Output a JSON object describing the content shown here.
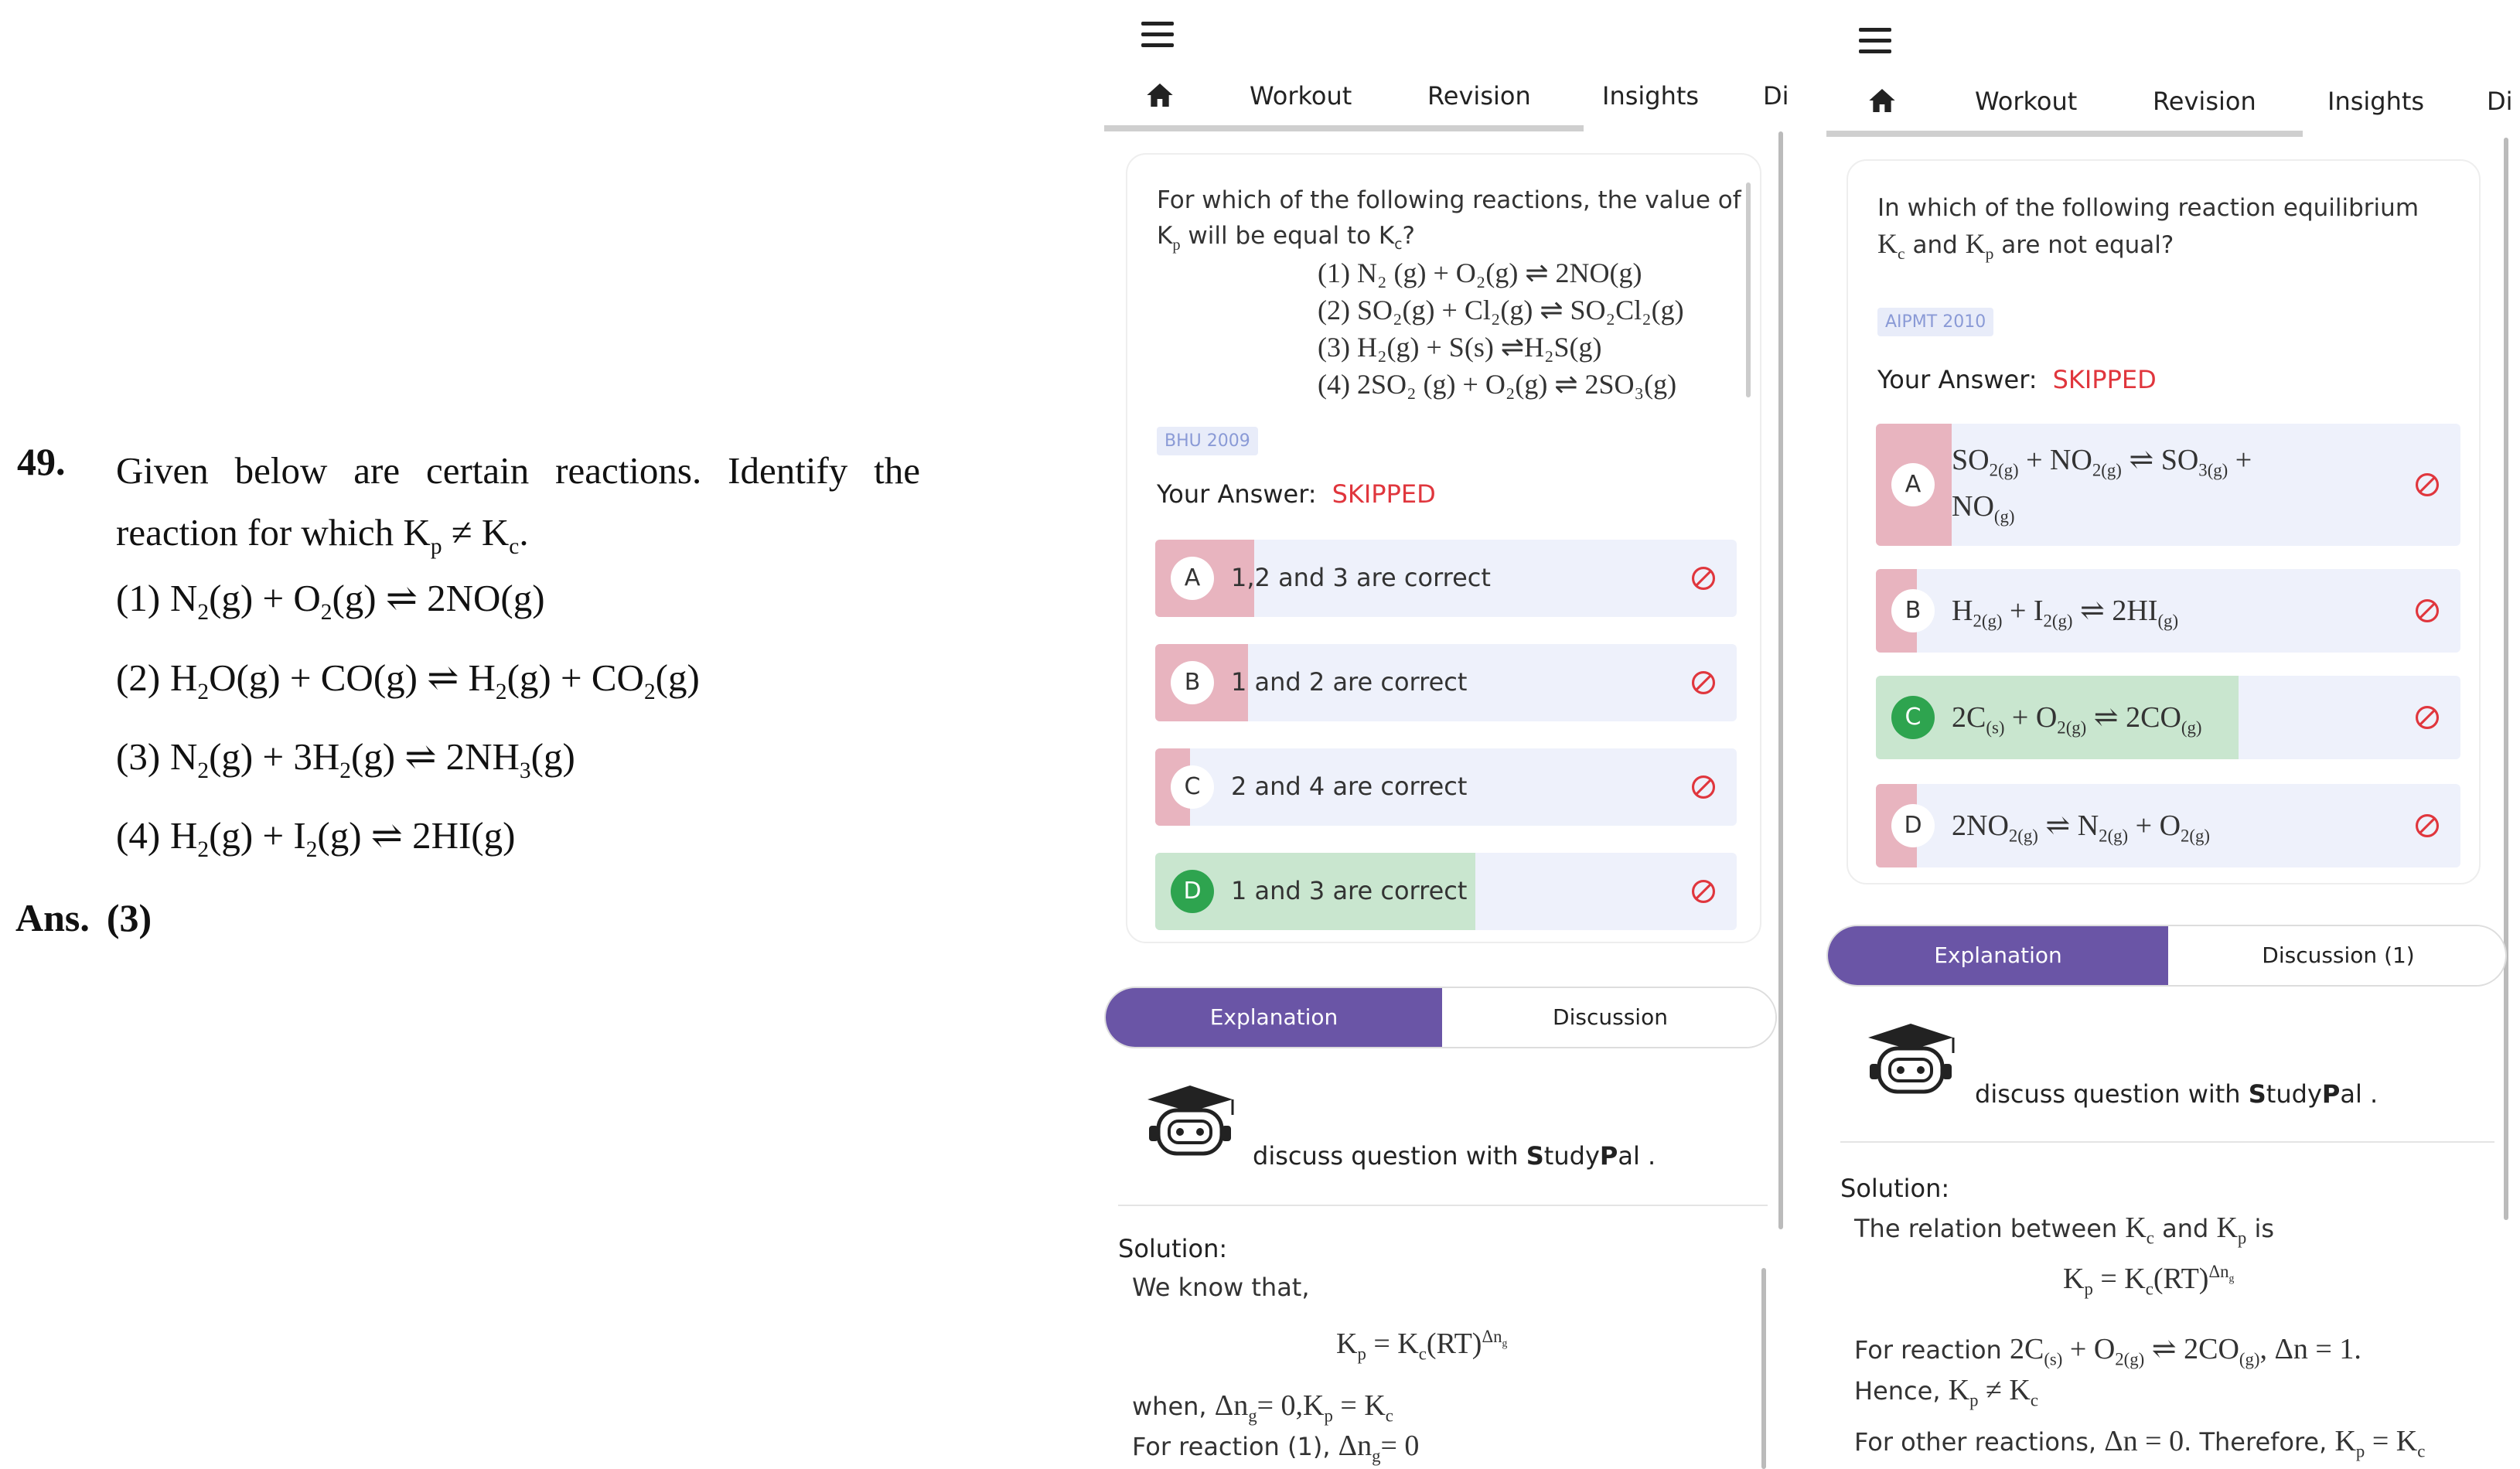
{
  "book": {
    "qnum": "49.",
    "question_line1": "Given below are certain reactions. Identify the",
    "question_line2": "reaction for which K",
    "options": [
      {
        "n": "(1)",
        "text": "N2(g) + O2(g) ⇌ 2NO(g)"
      },
      {
        "n": "(2)",
        "text": "H2O(g) + CO(g) ⇌ H2(g) + CO2(g)"
      },
      {
        "n": "(3)",
        "text": "N2(g) + 3H2(g) ⇌ 2NH3(g)"
      },
      {
        "n": "(4)",
        "text": "H2(g) + I2(g) ⇌ 2HI(g)"
      }
    ],
    "ans_label": "Ans.",
    "ans_value": "(3)"
  },
  "panel1": {
    "tabs": [
      "Workout",
      "Revision",
      "Insights",
      "Di"
    ],
    "question": "For which of the following reactions, the value of K",
    "reactions": [
      "(1) N₂ (g) + O₂(g) ⇌ 2NO(g)",
      "(2) SO₂(g) + Cl₂(g) ⇌ SO₂Cl₂(g)",
      "(3) H₂(g) + S(s) ⇌H₂S(g)",
      "(4) 2SO₂ (g) + O₂(g) ⇌ 2SO₃(g)"
    ],
    "badge": "BHU 2009",
    "your_answer_label": "Your Answer:",
    "your_answer_value": "SKIPPED",
    "options": [
      {
        "letter": "A",
        "text": "1,2 and 3 are correct",
        "fill": 0.17,
        "color": "#e8b4bf"
      },
      {
        "letter": "B",
        "text": "1 and 2 are correct",
        "fill": 0.16,
        "color": "#e8b4bf"
      },
      {
        "letter": "C",
        "text": "2 and 4 are correct",
        "fill": 0.06,
        "color": "#e8b4bf"
      },
      {
        "letter": "D",
        "text": "1 and 3 are correct",
        "fill": 0.55,
        "color": "#c9e6cf",
        "correct": true
      }
    ],
    "explanation": "Explanation",
    "discussion": "Discussion",
    "discuss_text": "discuss question with ",
    "studypal_s": "S",
    "studypal_tudy": "tudy",
    "studypal_p": "P",
    "studypal_al": "al .",
    "solution_label": "Solution:",
    "sol_we_know": "We know that,",
    "sol_formula": "Kp = Kc(RT)^Δng",
    "sol_when": "when, Δng= 0,Kp = Kc",
    "sol_reaction": "For reaction (1), Δng= 0"
  },
  "panel2": {
    "tabs": [
      "Workout",
      "Revision",
      "Insights",
      "Di"
    ],
    "question_line1": "In which of the following reaction equilibrium",
    "question_line2": "Kc and Kp are not equal?",
    "badge": "AIPMT 2010",
    "your_answer_label": "Your Answer:",
    "your_answer_value": "SKIPPED",
    "options": [
      {
        "letter": "A",
        "text": "SO2(g) + NO2(g) ⇌ SO3(g) + NO(g)",
        "fill": 0.13,
        "color": "#e8b4bf"
      },
      {
        "letter": "B",
        "text": "H2(g) + I2(g) ⇌ 2HI(g)",
        "fill": 0.07,
        "color": "#e8b4bf"
      },
      {
        "letter": "C",
        "text": "2C(s) + O2(g) ⇌ 2CO(g)",
        "fill": 0.62,
        "color": "#c9e6cf",
        "correct": true
      },
      {
        "letter": "D",
        "text": "2NO2(g) ⇌ N2(g) + O2(g)",
        "fill": 0.07,
        "color": "#e8b4bf"
      }
    ],
    "explanation": "Explanation",
    "discussion": "Discussion (1)",
    "discuss_text": "discuss question with ",
    "studypal_s": "S",
    "studypal_tudy": "tudy",
    "studypal_p": "P",
    "studypal_al": "al .",
    "solution_label": "Solution:",
    "sol_relation": "The relation between Kc and Kp is",
    "sol_formula": "Kp = Kc(RT)^Δng",
    "sol_for_reaction": "For reaction 2C(s) + O2(g) ⇌ 2CO(g), Δn = 1.",
    "sol_hence": "Hence, Kp ≠ Kc",
    "sol_other": "For other reactions, Δn = 0. Therefore, Kp = Kc"
  }
}
